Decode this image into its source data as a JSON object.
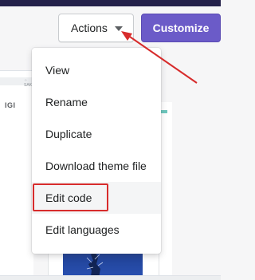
{
  "header": {
    "actions_label": "Actions",
    "customize_label": "Customize"
  },
  "menu": {
    "items": [
      {
        "label": "View"
      },
      {
        "label": "Rename"
      },
      {
        "label": "Duplicate"
      },
      {
        "label": "Download theme file"
      },
      {
        "label": "Edit code"
      },
      {
        "label": "Edit languages"
      }
    ],
    "highlighted_item": "Edit code"
  },
  "preview": {
    "partial_text": "IGI"
  },
  "colors": {
    "customize_bg": "#6b5bc8",
    "annotation_red": "#d72c2c",
    "top_strip": "#24214a"
  }
}
